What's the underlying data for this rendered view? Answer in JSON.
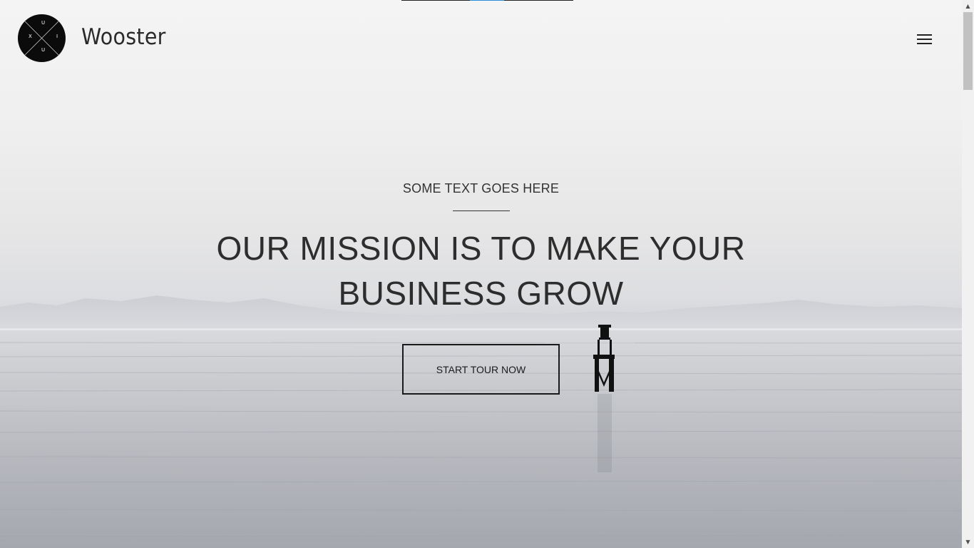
{
  "header": {
    "brand": "Wooster",
    "logo_letters": {
      "top": "U",
      "left": "X",
      "right": "I",
      "bottom": "U"
    },
    "menu_icon": "hamburger-menu-icon"
  },
  "hero": {
    "eyebrow": "SOME TEXT GOES HERE",
    "headline": "OUR MISSION IS TO MAKE YOUR BUSINESS GROW",
    "cta_label": "START TOUR NOW"
  },
  "colors": {
    "text": "#2d2d2d",
    "logo_bg": "#0b0b0b",
    "loader_accent": "#2a8fd6"
  },
  "scrollbar": {
    "up_icon": "scroll-up-arrow-icon",
    "down_icon": "scroll-down-arrow-icon"
  }
}
